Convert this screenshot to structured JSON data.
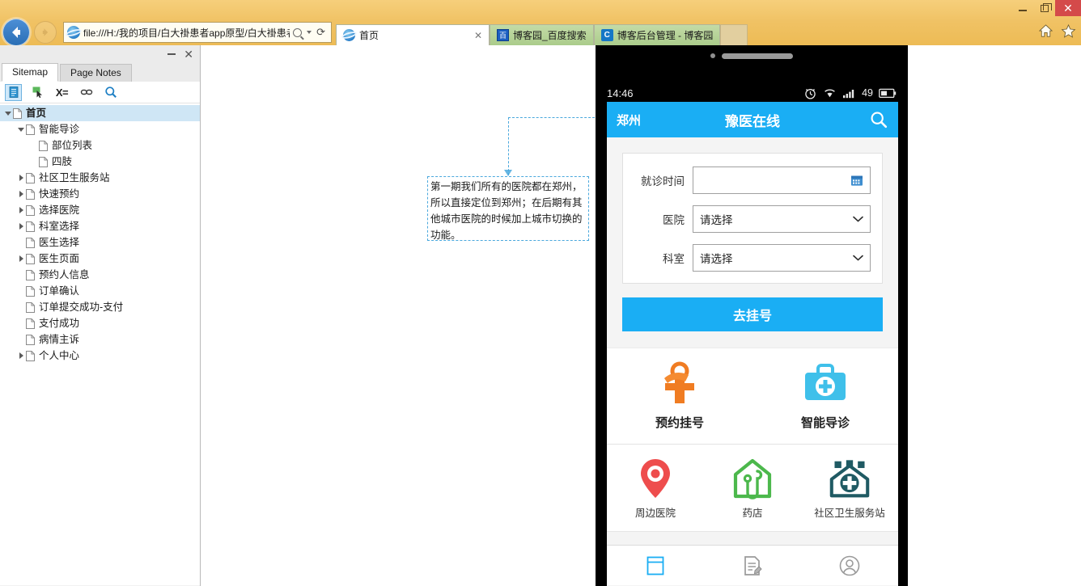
{
  "browser": {
    "address": "file:///H:/我的项目/白大褂患者app原型/白大褂患者a",
    "back_title": "Back",
    "forward_title": "Forward",
    "refresh_glyph": "⟳",
    "tabs": [
      {
        "label": "首页",
        "favicon": "ie-icon",
        "active": true,
        "close": "✕"
      },
      {
        "label": "博客园_百度搜索",
        "favicon": "baidu-icon",
        "active": false,
        "close": ""
      },
      {
        "label": "博客后台管理 - 博客园",
        "favicon": "cnblogs-icon",
        "active": false,
        "close": ""
      }
    ],
    "window_controls": {
      "minimize": "minimize-icon",
      "restore": "restore-icon",
      "close": "✕"
    },
    "right_icons": [
      "home-icon",
      "favorites-star-icon"
    ]
  },
  "sitemap_panel": {
    "titlebar": {
      "minimize": "minimize-icon",
      "close": "✕"
    },
    "tabs": [
      {
        "label": "Sitemap",
        "active": true
      },
      {
        "label": "Page Notes",
        "active": false
      }
    ],
    "toolbar": [
      {
        "name": "page-view-icon",
        "label": "",
        "active": true
      },
      {
        "name": "cursor-select-icon",
        "label": "",
        "active": false
      },
      {
        "name": "variables-icon",
        "label": "X=",
        "active": false
      },
      {
        "name": "link-icon",
        "label": "",
        "active": false
      },
      {
        "name": "search-icon",
        "label": "",
        "active": false
      }
    ],
    "tree": [
      {
        "label": "首页",
        "depth": 0,
        "twisty": "down",
        "selected": true
      },
      {
        "label": "智能导诊",
        "depth": 1,
        "twisty": "down",
        "selected": false
      },
      {
        "label": "部位列表",
        "depth": 2,
        "twisty": "none",
        "selected": false
      },
      {
        "label": "四肢",
        "depth": 2,
        "twisty": "none",
        "selected": false
      },
      {
        "label": "社区卫生服务站",
        "depth": 1,
        "twisty": "right",
        "selected": false
      },
      {
        "label": "快速预约",
        "depth": 1,
        "twisty": "right",
        "selected": false
      },
      {
        "label": "选择医院",
        "depth": 1,
        "twisty": "right",
        "selected": false
      },
      {
        "label": "科室选择",
        "depth": 1,
        "twisty": "right",
        "selected": false
      },
      {
        "label": "医生选择",
        "depth": 1,
        "twisty": "none",
        "selected": false
      },
      {
        "label": "医生页面",
        "depth": 1,
        "twisty": "right",
        "selected": false
      },
      {
        "label": "预约人信息",
        "depth": 1,
        "twisty": "none",
        "selected": false
      },
      {
        "label": "订单确认",
        "depth": 1,
        "twisty": "none",
        "selected": false
      },
      {
        "label": "订单提交成功-支付",
        "depth": 1,
        "twisty": "none",
        "selected": false
      },
      {
        "label": "支付成功",
        "depth": 1,
        "twisty": "none",
        "selected": false
      },
      {
        "label": "病情主诉",
        "depth": 1,
        "twisty": "none",
        "selected": false
      },
      {
        "label": "个人中心",
        "depth": 1,
        "twisty": "right",
        "selected": false
      }
    ]
  },
  "canvas": {
    "annotation": {
      "text": "第一期我们所有的医院都在郑州，所以直接定位到郑州；在后期有其他城市医院的时候加上城市切换的功能。",
      "border_color": "#4aa8dd"
    }
  },
  "phone": {
    "statusbar": {
      "time": "14:46",
      "icons": [
        "alarm-icon",
        "wifi-icon",
        "signal-icon"
      ],
      "battery_level": "49",
      "battery_icon": "battery-icon"
    },
    "header": {
      "city": "郑州",
      "title": "豫医在线",
      "search_icon": "search-icon",
      "background": "#1aaef4"
    },
    "form": {
      "rows": [
        {
          "label": "就诊时间",
          "value": "",
          "control": "date",
          "icon": "calendar-icon"
        },
        {
          "label": "医院",
          "value": "请选择",
          "control": "select",
          "icon": "chevron-down-icon"
        },
        {
          "label": "科室",
          "value": "请选择",
          "control": "select",
          "icon": "chevron-down-icon"
        }
      ]
    },
    "primary_button": {
      "label": "去挂号",
      "color": "#1aaef4"
    },
    "main_tiles": [
      {
        "label": "预约挂号",
        "icon": "appointment-register-icon",
        "color": "#f07c22"
      },
      {
        "label": "智能导诊",
        "icon": "medical-bag-icon",
        "color": "#3fc0ea"
      }
    ],
    "service_tiles": [
      {
        "label": "周边医院",
        "icon": "location-pin-icon",
        "color": "#ee4d4d"
      },
      {
        "label": "药店",
        "icon": "pharmacy-house-icon",
        "color": "#4cb84c"
      },
      {
        "label": "社区卫生服务站",
        "icon": "community-health-icon",
        "color": "#1f5a63"
      }
    ],
    "bottom_nav": [
      {
        "label": "",
        "icon": "home-book-icon",
        "active": true
      },
      {
        "label": "",
        "icon": "orders-document-icon",
        "active": false
      },
      {
        "label": "",
        "icon": "profile-person-icon",
        "active": false
      }
    ]
  }
}
